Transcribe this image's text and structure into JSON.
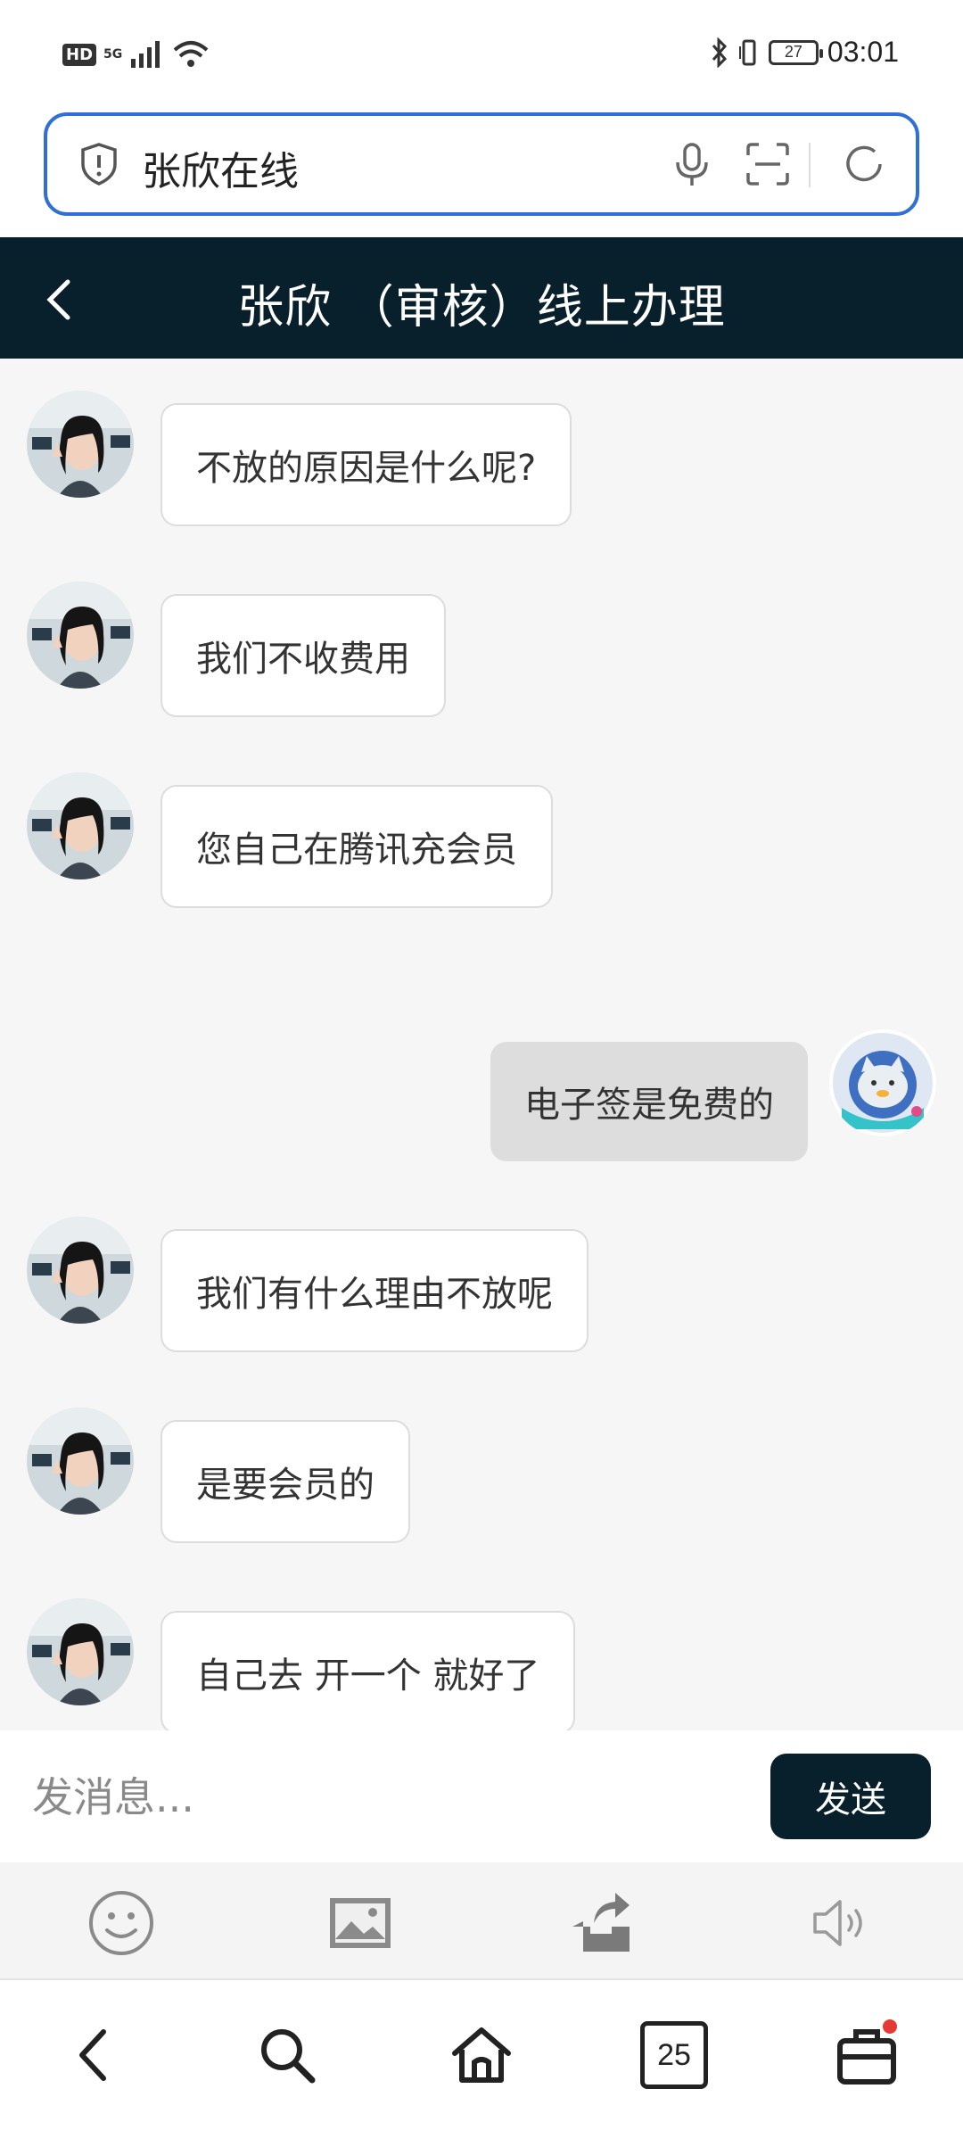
{
  "status_bar": {
    "network_badge": "HD",
    "network_type": "5G",
    "battery_level": "27",
    "time": "03:01"
  },
  "address_bar": {
    "query": "张欣在线"
  },
  "header": {
    "title": "张欣 （审核）线上办理"
  },
  "messages": [
    {
      "side": "in",
      "text": "不放的原因是什么呢?"
    },
    {
      "side": "in",
      "text": "我们不收费用"
    },
    {
      "side": "in",
      "text": "您自己在腾讯充会员"
    },
    {
      "side": "out",
      "text": "电子签是免费的"
    },
    {
      "side": "in",
      "text": "我们有什么理由不放呢"
    },
    {
      "side": "in",
      "text": "是要会员的"
    },
    {
      "side": "in",
      "text": "自己去 开一个 就好了"
    }
  ],
  "composer": {
    "placeholder": "发消息...",
    "send_label": "发送"
  },
  "toolbar": {
    "items": [
      "emoji-icon",
      "image-icon",
      "share-icon",
      "speaker-icon"
    ]
  },
  "navbar": {
    "tabs_count": "25"
  },
  "colors": {
    "header_bg": "#081f2c",
    "accent_border": "#2f6fd6",
    "notification_dot": "#e53935"
  }
}
